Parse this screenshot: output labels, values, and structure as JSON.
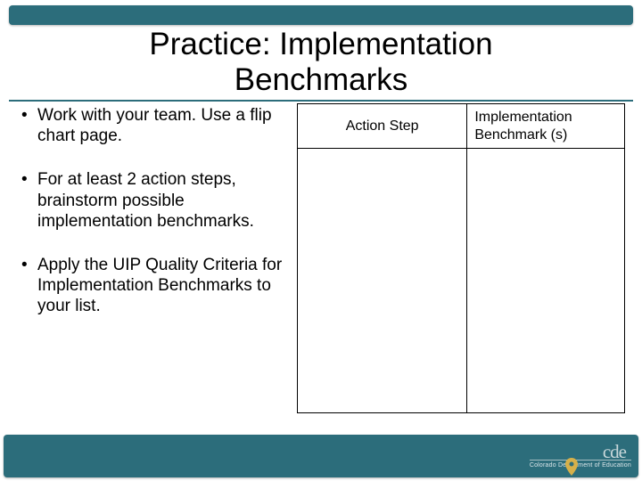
{
  "title_line1": "Practice: Implementation",
  "title_line2": "Benchmarks",
  "bullets": [
    "Work with your team. Use a flip chart page.",
    "For at least 2 action steps, brainstorm possible implementation benchmarks.",
    "Apply the UIP Quality Criteria for Implementation Benchmarks to your list."
  ],
  "table": {
    "header1": "Action Step",
    "header2": "Implementation Benchmark (s)"
  },
  "footer": {
    "logo_text": "cde",
    "org_name": "Colorado Department of Education"
  }
}
